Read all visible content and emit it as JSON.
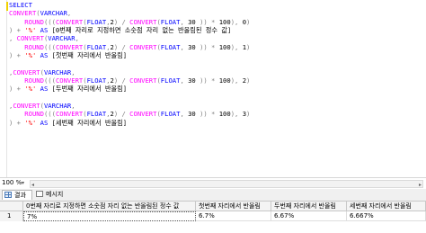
{
  "editor": {
    "lines": [
      [
        {
          "t": "SELECT",
          "c": "kw"
        }
      ],
      [
        {
          "t": "CONVERT",
          "c": "fn"
        },
        {
          "t": "(",
          "c": "op"
        },
        {
          "t": "VARCHAR",
          "c": "kw"
        },
        {
          "t": ",",
          "c": "op"
        }
      ],
      [
        {
          "t": "    ROUND",
          "c": "fn"
        },
        {
          "t": "(((",
          "c": "op"
        },
        {
          "t": "CONVERT",
          "c": "fn"
        },
        {
          "t": "(",
          "c": "op"
        },
        {
          "t": "FLOAT",
          "c": "kw"
        },
        {
          "t": ",",
          "c": "op"
        },
        {
          "t": "2",
          "c": "plain"
        },
        {
          "t": ") / ",
          "c": "op"
        },
        {
          "t": "CONVERT",
          "c": "fn"
        },
        {
          "t": "(",
          "c": "op"
        },
        {
          "t": "FLOAT",
          "c": "kw"
        },
        {
          "t": ", ",
          "c": "op"
        },
        {
          "t": "30",
          "c": "plain"
        },
        {
          "t": " )) * ",
          "c": "op"
        },
        {
          "t": "100",
          "c": "plain"
        },
        {
          "t": "), ",
          "c": "op"
        },
        {
          "t": "0",
          "c": "plain"
        },
        {
          "t": ")",
          "c": "op"
        }
      ],
      [
        {
          "t": ") + ",
          "c": "op"
        },
        {
          "t": "'%'",
          "c": "str"
        },
        {
          "t": " AS ",
          "c": "kw"
        },
        {
          "t": "[0번째 자리로 지정하면 소숫점 자리 없는 반올림된 정수 값]",
          "c": "txt"
        }
      ],
      [
        {
          "t": ", ",
          "c": "op"
        },
        {
          "t": "CONVERT",
          "c": "fn"
        },
        {
          "t": "(",
          "c": "op"
        },
        {
          "t": "VARCHAR",
          "c": "kw"
        },
        {
          "t": ",",
          "c": "op"
        }
      ],
      [
        {
          "t": "    ROUND",
          "c": "fn"
        },
        {
          "t": "(((",
          "c": "op"
        },
        {
          "t": "CONVERT",
          "c": "fn"
        },
        {
          "t": "(",
          "c": "op"
        },
        {
          "t": "FLOAT",
          "c": "kw"
        },
        {
          "t": ",",
          "c": "op"
        },
        {
          "t": "2",
          "c": "plain"
        },
        {
          "t": ") / ",
          "c": "op"
        },
        {
          "t": "CONVERT",
          "c": "fn"
        },
        {
          "t": "(",
          "c": "op"
        },
        {
          "t": "FLOAT",
          "c": "kw"
        },
        {
          "t": ", ",
          "c": "op"
        },
        {
          "t": "30",
          "c": "plain"
        },
        {
          "t": " )) * ",
          "c": "op"
        },
        {
          "t": "100",
          "c": "plain"
        },
        {
          "t": "), ",
          "c": "op"
        },
        {
          "t": "1",
          "c": "plain"
        },
        {
          "t": ")",
          "c": "op"
        }
      ],
      [
        {
          "t": ") + ",
          "c": "op"
        },
        {
          "t": "'%'",
          "c": "str"
        },
        {
          "t": " AS ",
          "c": "kw"
        },
        {
          "t": "[첫번째 자리에서 반올림]",
          "c": "txt"
        }
      ],
      [
        {
          "t": "",
          "c": "plain"
        }
      ],
      [
        {
          "t": ",",
          "c": "op"
        },
        {
          "t": "CONVERT",
          "c": "fn"
        },
        {
          "t": "(",
          "c": "op"
        },
        {
          "t": "VARCHAR",
          "c": "kw"
        },
        {
          "t": ",",
          "c": "op"
        }
      ],
      [
        {
          "t": "    ROUND",
          "c": "fn"
        },
        {
          "t": "(((",
          "c": "op"
        },
        {
          "t": "CONVERT",
          "c": "fn"
        },
        {
          "t": "(",
          "c": "op"
        },
        {
          "t": "FLOAT",
          "c": "kw"
        },
        {
          "t": ",",
          "c": "op"
        },
        {
          "t": "2",
          "c": "plain"
        },
        {
          "t": ") / ",
          "c": "op"
        },
        {
          "t": "CONVERT",
          "c": "fn"
        },
        {
          "t": "(",
          "c": "op"
        },
        {
          "t": "FLOAT",
          "c": "kw"
        },
        {
          "t": ", ",
          "c": "op"
        },
        {
          "t": "30",
          "c": "plain"
        },
        {
          "t": " )) * ",
          "c": "op"
        },
        {
          "t": "100",
          "c": "plain"
        },
        {
          "t": "), ",
          "c": "op"
        },
        {
          "t": "2",
          "c": "plain"
        },
        {
          "t": ")",
          "c": "op"
        }
      ],
      [
        {
          "t": ") + ",
          "c": "op"
        },
        {
          "t": "'%'",
          "c": "str"
        },
        {
          "t": " AS ",
          "c": "kw"
        },
        {
          "t": "[두번째 자리에서 반올림]",
          "c": "txt"
        }
      ],
      [
        {
          "t": "",
          "c": "plain"
        }
      ],
      [
        {
          "t": ",",
          "c": "op"
        },
        {
          "t": "CONVERT",
          "c": "fn"
        },
        {
          "t": "(",
          "c": "op"
        },
        {
          "t": "VARCHAR",
          "c": "kw"
        },
        {
          "t": ",",
          "c": "op"
        }
      ],
      [
        {
          "t": "    ROUND",
          "c": "fn"
        },
        {
          "t": "(((",
          "c": "op"
        },
        {
          "t": "CONVERT",
          "c": "fn"
        },
        {
          "t": "(",
          "c": "op"
        },
        {
          "t": "FLOAT",
          "c": "kw"
        },
        {
          "t": ",",
          "c": "op"
        },
        {
          "t": "2",
          "c": "plain"
        },
        {
          "t": ") / ",
          "c": "op"
        },
        {
          "t": "CONVERT",
          "c": "fn"
        },
        {
          "t": "(",
          "c": "op"
        },
        {
          "t": "FLOAT",
          "c": "kw"
        },
        {
          "t": ", ",
          "c": "op"
        },
        {
          "t": "30",
          "c": "plain"
        },
        {
          "t": " )) * ",
          "c": "op"
        },
        {
          "t": "100",
          "c": "plain"
        },
        {
          "t": "), ",
          "c": "op"
        },
        {
          "t": "3",
          "c": "plain"
        },
        {
          "t": ")",
          "c": "op"
        }
      ],
      [
        {
          "t": ") + ",
          "c": "op"
        },
        {
          "t": "'%'",
          "c": "str"
        },
        {
          "t": " AS ",
          "c": "kw"
        },
        {
          "t": "[세번째 자리에서 반올림]",
          "c": "txt"
        }
      ]
    ]
  },
  "zoom": {
    "value": "100 %",
    "caret": "▾"
  },
  "tabs": {
    "results": "결과",
    "messages": "메시지"
  },
  "grid": {
    "headers": [
      "0번째 자리로 지정하면 소숫점 자리 없는 반올림된 정수 값",
      "첫번째 자리에서 반올림",
      "두번째 자리에서 반올림",
      "세번째 자리에서 반올림"
    ],
    "row_number": "1",
    "values": [
      "7%",
      "6.7%",
      "6.67%",
      "6.667%"
    ]
  },
  "colors": {
    "keyword": "#0000ff",
    "function": "#ff00ff",
    "string": "#ff0000",
    "operator": "#808080"
  }
}
